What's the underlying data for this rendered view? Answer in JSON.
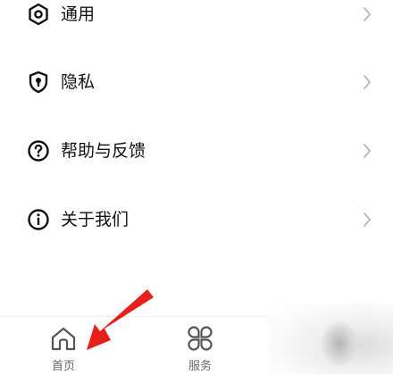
{
  "menu": {
    "items": [
      {
        "label": "通用",
        "icon": "gear-icon"
      },
      {
        "label": "隐私",
        "icon": "shield-lock-icon"
      },
      {
        "label": "帮助与反馈",
        "icon": "question-circle-icon"
      },
      {
        "label": "关于我们",
        "icon": "info-circle-icon"
      }
    ],
    "chevron_icon": "chevron-right-icon"
  },
  "tabbar": {
    "home": {
      "label": "首页",
      "icon": "home-icon"
    },
    "services": {
      "label": "服务",
      "icon": "grid-petals-icon"
    }
  },
  "annotation": {
    "arrow_color": "#e8201a"
  },
  "colors": {
    "text": "#111111",
    "tab_text": "#666666",
    "chevron": "#b8b8b8"
  }
}
